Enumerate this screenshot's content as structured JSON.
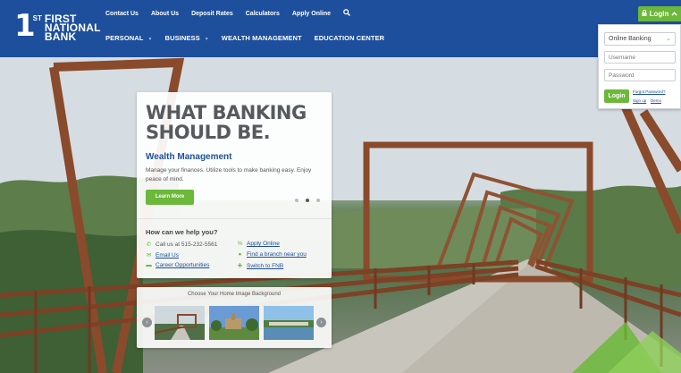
{
  "brand": {
    "logo_numeral": "1",
    "logo_suffix": "ST",
    "logo_line1": "FIRST",
    "logo_line2": "NATIONAL",
    "logo_line3": "BANK",
    "color_primary": "#1d4f9c",
    "color_accent": "#6cb83a"
  },
  "utility_nav": [
    "Contact Us",
    "About Us",
    "Deposit Rates",
    "Calculators",
    "Apply Online"
  ],
  "search_icon": "search-icon",
  "main_nav": {
    "personal": "PERSONAL",
    "business": "BUSINESS",
    "wealth": "WEALTH MANAGEMENT",
    "education": "EDUCATION CENTER"
  },
  "login": {
    "tab_label": "Login",
    "selected_option": "Online Banking",
    "username_placeholder": "Username",
    "password_placeholder": "Password",
    "button_label": "Login",
    "forgot_label": "Forgot Password?",
    "signup_label": "Sign up",
    "demo_label": "Demo"
  },
  "card": {
    "headline_line1": "WHAT BANKING",
    "headline_line2": "SHOULD BE.",
    "subheading": "Wealth Management",
    "description": "Manage your finances. Utilize tools to make banking easy. Enjoy peace of mind.",
    "cta_label": "Learn More",
    "help_title": "How can we help you?",
    "call_text": "Call us at 515-232-5561",
    "email_label": "Email Us",
    "careers_label": "Career Opportunities",
    "apply_label": "Apply Online",
    "branch_label": "Find a branch near you",
    "switch_label": "Switch to FNB"
  },
  "chooser": {
    "title": "Choose Your Home Image Background"
  }
}
